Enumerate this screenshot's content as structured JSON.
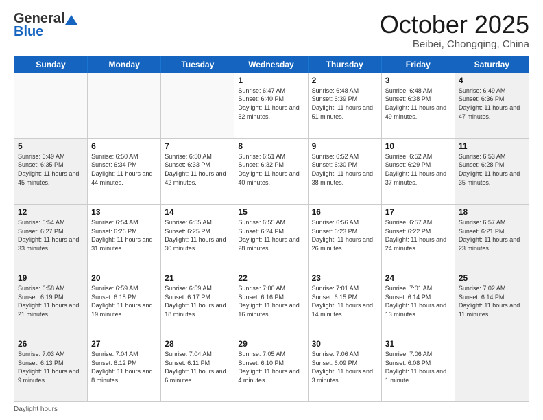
{
  "header": {
    "logo_general": "General",
    "logo_blue": "Blue",
    "title": "October 2025",
    "location": "Beibei, Chongqing, China"
  },
  "weekdays": [
    "Sunday",
    "Monday",
    "Tuesday",
    "Wednesday",
    "Thursday",
    "Friday",
    "Saturday"
  ],
  "rows": [
    [
      {
        "day": "",
        "text": "",
        "shaded": false,
        "empty": true
      },
      {
        "day": "",
        "text": "",
        "shaded": false,
        "empty": true
      },
      {
        "day": "",
        "text": "",
        "shaded": false,
        "empty": true
      },
      {
        "day": "1",
        "text": "Sunrise: 6:47 AM\nSunset: 6:40 PM\nDaylight: 11 hours\nand 52 minutes.",
        "shaded": false,
        "empty": false
      },
      {
        "day": "2",
        "text": "Sunrise: 6:48 AM\nSunset: 6:39 PM\nDaylight: 11 hours\nand 51 minutes.",
        "shaded": false,
        "empty": false
      },
      {
        "day": "3",
        "text": "Sunrise: 6:48 AM\nSunset: 6:38 PM\nDaylight: 11 hours\nand 49 minutes.",
        "shaded": false,
        "empty": false
      },
      {
        "day": "4",
        "text": "Sunrise: 6:49 AM\nSunset: 6:36 PM\nDaylight: 11 hours\nand 47 minutes.",
        "shaded": true,
        "empty": false
      }
    ],
    [
      {
        "day": "5",
        "text": "Sunrise: 6:49 AM\nSunset: 6:35 PM\nDaylight: 11 hours\nand 45 minutes.",
        "shaded": true,
        "empty": false
      },
      {
        "day": "6",
        "text": "Sunrise: 6:50 AM\nSunset: 6:34 PM\nDaylight: 11 hours\nand 44 minutes.",
        "shaded": false,
        "empty": false
      },
      {
        "day": "7",
        "text": "Sunrise: 6:50 AM\nSunset: 6:33 PM\nDaylight: 11 hours\nand 42 minutes.",
        "shaded": false,
        "empty": false
      },
      {
        "day": "8",
        "text": "Sunrise: 6:51 AM\nSunset: 6:32 PM\nDaylight: 11 hours\nand 40 minutes.",
        "shaded": false,
        "empty": false
      },
      {
        "day": "9",
        "text": "Sunrise: 6:52 AM\nSunset: 6:30 PM\nDaylight: 11 hours\nand 38 minutes.",
        "shaded": false,
        "empty": false
      },
      {
        "day": "10",
        "text": "Sunrise: 6:52 AM\nSunset: 6:29 PM\nDaylight: 11 hours\nand 37 minutes.",
        "shaded": false,
        "empty": false
      },
      {
        "day": "11",
        "text": "Sunrise: 6:53 AM\nSunset: 6:28 PM\nDaylight: 11 hours\nand 35 minutes.",
        "shaded": true,
        "empty": false
      }
    ],
    [
      {
        "day": "12",
        "text": "Sunrise: 6:54 AM\nSunset: 6:27 PM\nDaylight: 11 hours\nand 33 minutes.",
        "shaded": true,
        "empty": false
      },
      {
        "day": "13",
        "text": "Sunrise: 6:54 AM\nSunset: 6:26 PM\nDaylight: 11 hours\nand 31 minutes.",
        "shaded": false,
        "empty": false
      },
      {
        "day": "14",
        "text": "Sunrise: 6:55 AM\nSunset: 6:25 PM\nDaylight: 11 hours\nand 30 minutes.",
        "shaded": false,
        "empty": false
      },
      {
        "day": "15",
        "text": "Sunrise: 6:55 AM\nSunset: 6:24 PM\nDaylight: 11 hours\nand 28 minutes.",
        "shaded": false,
        "empty": false
      },
      {
        "day": "16",
        "text": "Sunrise: 6:56 AM\nSunset: 6:23 PM\nDaylight: 11 hours\nand 26 minutes.",
        "shaded": false,
        "empty": false
      },
      {
        "day": "17",
        "text": "Sunrise: 6:57 AM\nSunset: 6:22 PM\nDaylight: 11 hours\nand 24 minutes.",
        "shaded": false,
        "empty": false
      },
      {
        "day": "18",
        "text": "Sunrise: 6:57 AM\nSunset: 6:21 PM\nDaylight: 11 hours\nand 23 minutes.",
        "shaded": true,
        "empty": false
      }
    ],
    [
      {
        "day": "19",
        "text": "Sunrise: 6:58 AM\nSunset: 6:19 PM\nDaylight: 11 hours\nand 21 minutes.",
        "shaded": true,
        "empty": false
      },
      {
        "day": "20",
        "text": "Sunrise: 6:59 AM\nSunset: 6:18 PM\nDaylight: 11 hours\nand 19 minutes.",
        "shaded": false,
        "empty": false
      },
      {
        "day": "21",
        "text": "Sunrise: 6:59 AM\nSunset: 6:17 PM\nDaylight: 11 hours\nand 18 minutes.",
        "shaded": false,
        "empty": false
      },
      {
        "day": "22",
        "text": "Sunrise: 7:00 AM\nSunset: 6:16 PM\nDaylight: 11 hours\nand 16 minutes.",
        "shaded": false,
        "empty": false
      },
      {
        "day": "23",
        "text": "Sunrise: 7:01 AM\nSunset: 6:15 PM\nDaylight: 11 hours\nand 14 minutes.",
        "shaded": false,
        "empty": false
      },
      {
        "day": "24",
        "text": "Sunrise: 7:01 AM\nSunset: 6:14 PM\nDaylight: 11 hours\nand 13 minutes.",
        "shaded": false,
        "empty": false
      },
      {
        "day": "25",
        "text": "Sunrise: 7:02 AM\nSunset: 6:14 PM\nDaylight: 11 hours\nand 11 minutes.",
        "shaded": true,
        "empty": false
      }
    ],
    [
      {
        "day": "26",
        "text": "Sunrise: 7:03 AM\nSunset: 6:13 PM\nDaylight: 11 hours\nand 9 minutes.",
        "shaded": true,
        "empty": false
      },
      {
        "day": "27",
        "text": "Sunrise: 7:04 AM\nSunset: 6:12 PM\nDaylight: 11 hours\nand 8 minutes.",
        "shaded": false,
        "empty": false
      },
      {
        "day": "28",
        "text": "Sunrise: 7:04 AM\nSunset: 6:11 PM\nDaylight: 11 hours\nand 6 minutes.",
        "shaded": false,
        "empty": false
      },
      {
        "day": "29",
        "text": "Sunrise: 7:05 AM\nSunset: 6:10 PM\nDaylight: 11 hours\nand 4 minutes.",
        "shaded": false,
        "empty": false
      },
      {
        "day": "30",
        "text": "Sunrise: 7:06 AM\nSunset: 6:09 PM\nDaylight: 11 hours\nand 3 minutes.",
        "shaded": false,
        "empty": false
      },
      {
        "day": "31",
        "text": "Sunrise: 7:06 AM\nSunset: 6:08 PM\nDaylight: 11 hours\nand 1 minute.",
        "shaded": false,
        "empty": false
      },
      {
        "day": "",
        "text": "",
        "shaded": true,
        "empty": true
      }
    ]
  ],
  "footer": {
    "note": "Daylight hours"
  }
}
